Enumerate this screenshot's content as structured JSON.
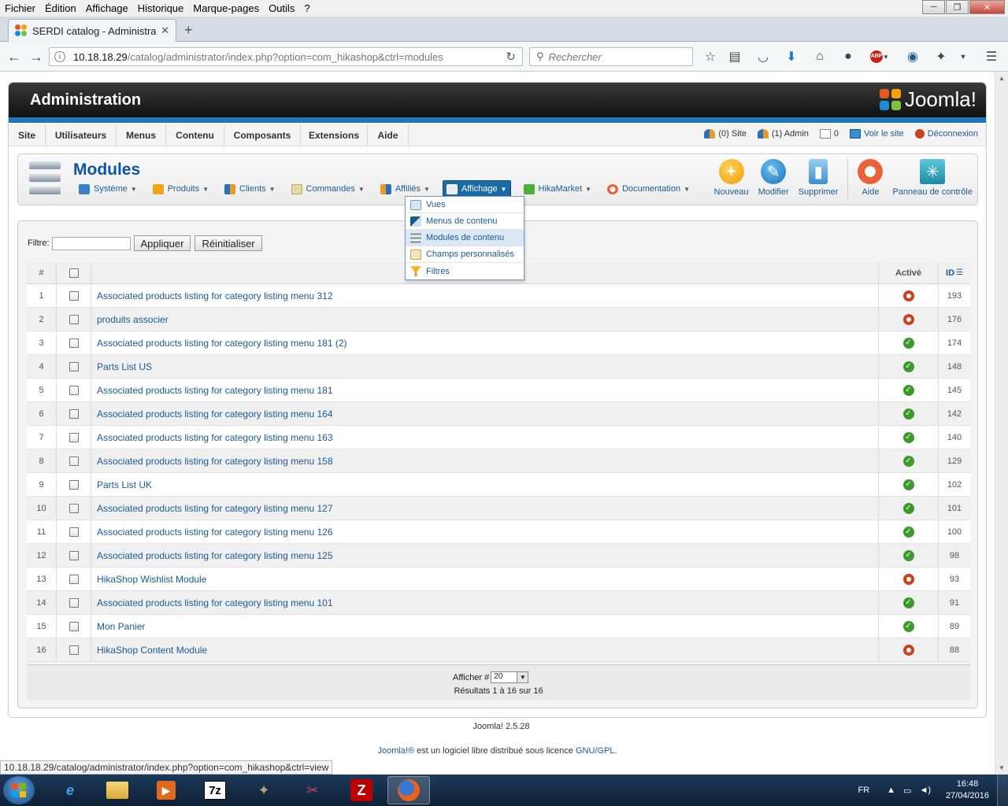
{
  "browser": {
    "menubar": [
      "Fichier",
      "Édition",
      "Affichage",
      "Historique",
      "Marque-pages",
      "Outils",
      "?"
    ],
    "tab_title": "SERDI catalog - Administra...",
    "url_host": "10.18.18.29",
    "url_path": "/catalog/administrator/index.php?option=com_hikashop&ctrl=modules",
    "search_placeholder": "Rechercher",
    "status_url": "10.18.18.29/catalog/administrator/index.php?option=com_hikashop&ctrl=view"
  },
  "header": {
    "title": "Administration",
    "logo_text": "Joomla!"
  },
  "topmenu": {
    "items": [
      "Site",
      "Utilisateurs",
      "Menus",
      "Contenu",
      "Composants",
      "Extensions",
      "Aide"
    ],
    "site_status": "(0) Site",
    "admin_status": "(1) Admin",
    "messages": "0",
    "view_site": "Voir le site",
    "logout": "Déconnexion"
  },
  "page": {
    "title": "Modules",
    "submenu": [
      "Système",
      "Produits",
      "Clients",
      "Commandes",
      "Affiliés",
      "Affichage",
      "HikaMarket",
      "Documentation"
    ],
    "toolbar": [
      "Nouveau",
      "Modifier",
      "Supprimer",
      "Aide",
      "Panneau de contrôle"
    ]
  },
  "dropdown": {
    "items": [
      "Vues",
      "Menus de contenu",
      "Modules de contenu",
      "Champs personnalisés",
      "Filtres"
    ]
  },
  "filter": {
    "label": "Filtre:",
    "value": "",
    "apply": "Appliquer",
    "reset": "Réinitialiser"
  },
  "table": {
    "headers": {
      "num": "#",
      "active": "Activé",
      "id": "ID"
    },
    "rows": [
      {
        "num": "1",
        "name": "Associated products listing for category listing menu 312",
        "active": false,
        "id": "193"
      },
      {
        "num": "2",
        "name": "produits associer",
        "active": false,
        "id": "176"
      },
      {
        "num": "3",
        "name": "Associated products listing for category listing menu 181 (2)",
        "active": true,
        "id": "174"
      },
      {
        "num": "4",
        "name": "Parts List US",
        "active": true,
        "id": "148"
      },
      {
        "num": "5",
        "name": "Associated products listing for category listing menu 181",
        "active": true,
        "id": "145"
      },
      {
        "num": "6",
        "name": "Associated products listing for category listing menu 164",
        "active": true,
        "id": "142"
      },
      {
        "num": "7",
        "name": "Associated products listing for category listing menu 163",
        "active": true,
        "id": "140"
      },
      {
        "num": "8",
        "name": "Associated products listing for category listing menu 158",
        "active": true,
        "id": "129"
      },
      {
        "num": "9",
        "name": "Parts List UK",
        "active": true,
        "id": "102"
      },
      {
        "num": "10",
        "name": "Associated products listing for category listing menu 127",
        "active": true,
        "id": "101"
      },
      {
        "num": "11",
        "name": "Associated products listing for category listing menu 126",
        "active": true,
        "id": "100"
      },
      {
        "num": "12",
        "name": "Associated products listing for category listing menu 125",
        "active": true,
        "id": "98"
      },
      {
        "num": "13",
        "name": "HikaShop Wishlist Module",
        "active": false,
        "id": "93"
      },
      {
        "num": "14",
        "name": "Associated products listing for category listing menu 101",
        "active": true,
        "id": "91"
      },
      {
        "num": "15",
        "name": "Mon Panier",
        "active": true,
        "id": "89"
      },
      {
        "num": "16",
        "name": "HikaShop Content Module",
        "active": false,
        "id": "88"
      }
    ]
  },
  "pager": {
    "display_label": "Afficher #",
    "display_value": "20",
    "results": "Résultats 1 à 16 sur 16"
  },
  "footer": {
    "version": "Joomla! 2.5.28",
    "license_link": "Joomla!®",
    "license_text": " est un logiciel libre distribué sous licence ",
    "license_gpl": "GNU/GPL",
    "license_end": "."
  },
  "taskbar": {
    "lang": "FR",
    "time": "16:48",
    "date": "27/04/2016",
    "apps": [
      "internet-explorer",
      "file-explorer",
      "media-player",
      "7zip",
      "gimp",
      "snipping-tool",
      "filezilla",
      "firefox"
    ]
  },
  "colors": {
    "accent": "#1a5a94",
    "active_on": "#3c9a2c",
    "active_off": "#c8421d",
    "header_blue": "#1a78b9"
  }
}
